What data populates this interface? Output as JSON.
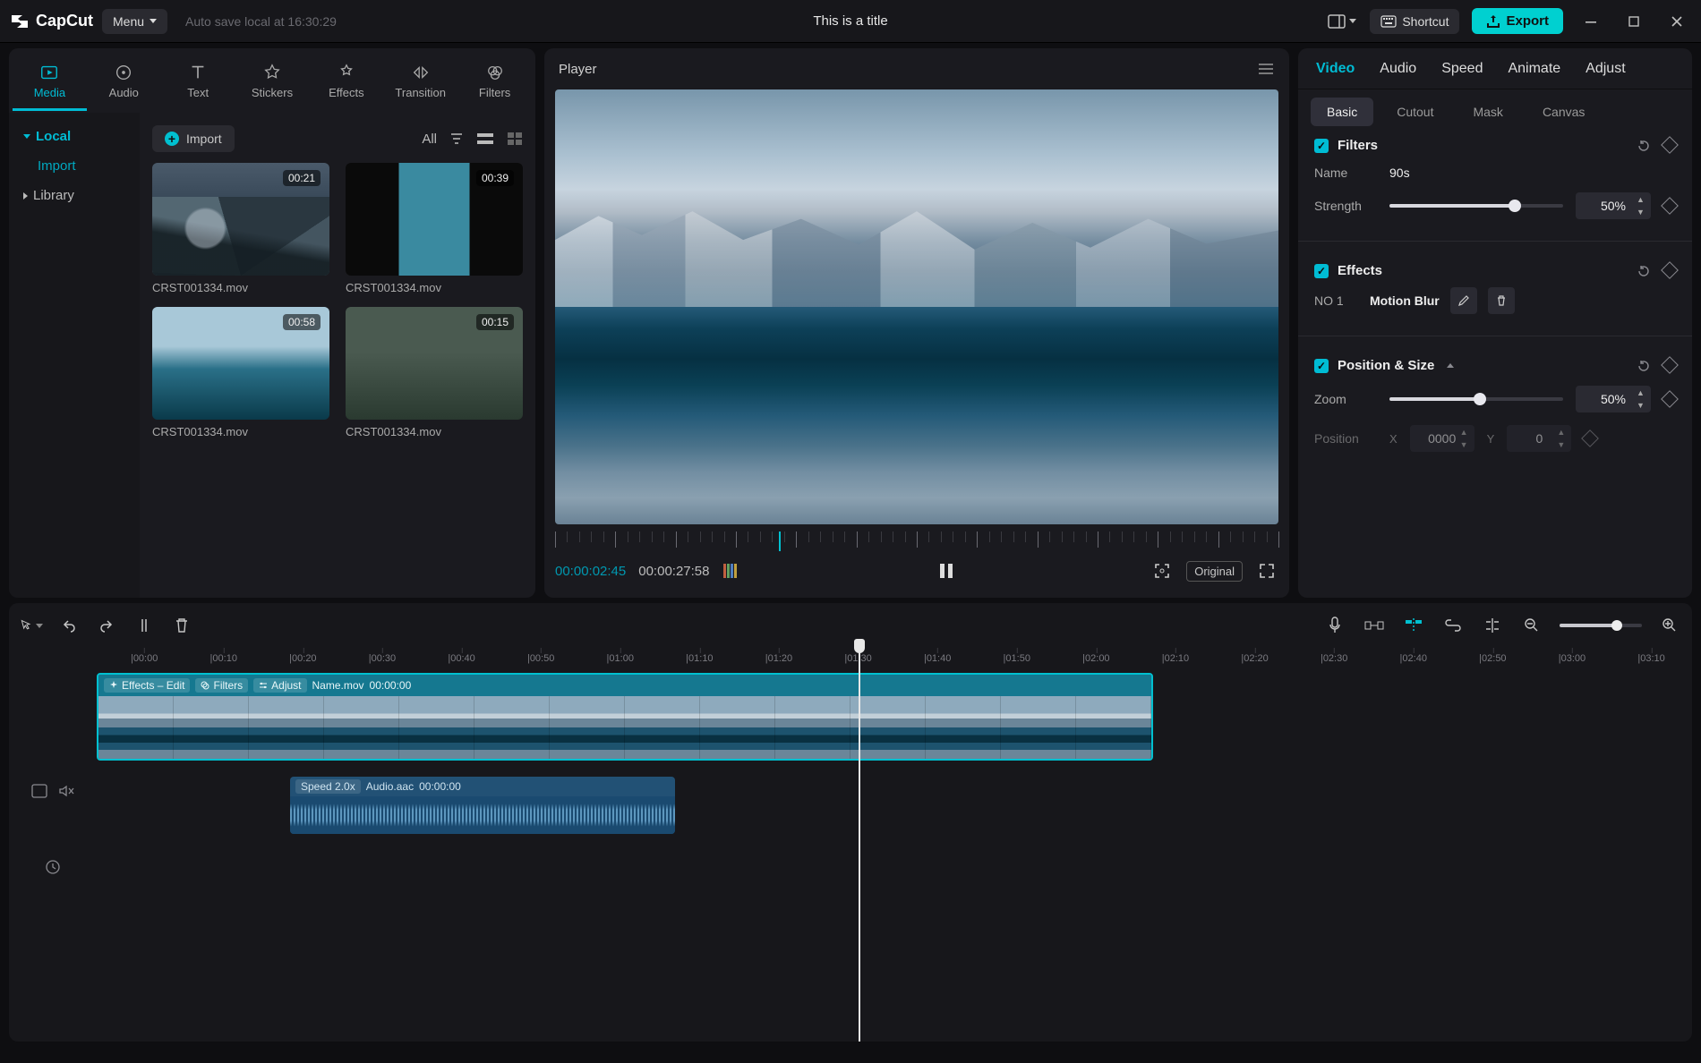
{
  "titlebar": {
    "brand": "CapCut",
    "menu_label": "Menu",
    "autosave": "Auto save local at 16:30:29",
    "project_title": "This is a title",
    "shortcut_label": "Shortcut",
    "export_label": "Export"
  },
  "tool_tabs": [
    {
      "id": "media",
      "label": "Media",
      "active": true
    },
    {
      "id": "audio",
      "label": "Audio",
      "active": false
    },
    {
      "id": "text",
      "label": "Text",
      "active": false
    },
    {
      "id": "stickers",
      "label": "Stickers",
      "active": false
    },
    {
      "id": "effects",
      "label": "Effects",
      "active": false
    },
    {
      "id": "transition",
      "label": "Transition",
      "active": false
    },
    {
      "id": "filters",
      "label": "Filters",
      "active": false
    }
  ],
  "media_sidebar": {
    "local": "Local",
    "import": "Import",
    "library": "Library"
  },
  "media_top": {
    "import_label": "Import",
    "all_label": "All"
  },
  "media_items": [
    {
      "name": "CRST001334.mov",
      "duration": "00:21"
    },
    {
      "name": "CRST001334.mov",
      "duration": "00:39"
    },
    {
      "name": "CRST001334.mov",
      "duration": "00:58"
    },
    {
      "name": "CRST001334.mov",
      "duration": "00:15"
    }
  ],
  "player": {
    "title": "Player",
    "current": "00:00:02:45",
    "total": "00:00:27:58",
    "original_label": "Original"
  },
  "inspector": {
    "tabs": [
      {
        "id": "video",
        "label": "Video",
        "active": true
      },
      {
        "id": "audio",
        "label": "Audio",
        "active": false
      },
      {
        "id": "speed",
        "label": "Speed",
        "active": false
      },
      {
        "id": "animate",
        "label": "Animate",
        "active": false
      },
      {
        "id": "adjust",
        "label": "Adjust",
        "active": false
      }
    ],
    "subtabs": [
      {
        "id": "basic",
        "label": "Basic",
        "active": true
      },
      {
        "id": "cutout",
        "label": "Cutout",
        "active": false
      },
      {
        "id": "mask",
        "label": "Mask",
        "active": false
      },
      {
        "id": "canvas",
        "label": "Canvas",
        "active": false
      }
    ],
    "filters": {
      "section": "Filters",
      "name_label": "Name",
      "name_value": "90s",
      "strength_label": "Strength",
      "strength_value": "50%",
      "strength_pct": 72
    },
    "effects": {
      "section": "Effects",
      "no_label": "NO 1",
      "name": "Motion Blur"
    },
    "possize": {
      "section": "Position & Size",
      "zoom_label": "Zoom",
      "zoom_value": "50%",
      "zoom_pct": 52,
      "position_label": "Position",
      "x_label": "X",
      "x_value": "0000",
      "y_label": "Y",
      "y_value": "0"
    }
  },
  "timeline": {
    "ruler": [
      "00:00",
      "00:10",
      "00:20",
      "00:30",
      "00:40",
      "00:50",
      "01:00",
      "01:10",
      "01:20",
      "01:30",
      "01:40",
      "01:50",
      "02:00",
      "02:10",
      "02:20",
      "02:30",
      "02:40",
      "02:50",
      "03:00",
      "03:10"
    ],
    "playhead_index": 9,
    "video_clip": {
      "tags": [
        "Effects – Edit",
        "Filters",
        "Adjust"
      ],
      "name": "Name.mov",
      "time": "00:00:00"
    },
    "audio_clip": {
      "speed": "Speed 2.0x",
      "name": "Audio.aac",
      "time": "00:00:00"
    }
  }
}
